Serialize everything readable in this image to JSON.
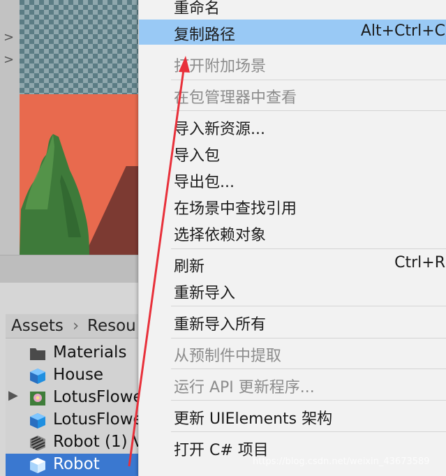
{
  "scene_panel": {
    "chevrons": [
      ">",
      ">"
    ]
  },
  "project_panel": {
    "breadcrumb": {
      "root": "Assets",
      "separator": "›",
      "current": "Resou"
    },
    "items": [
      {
        "label": "Materials",
        "icon": "folder-icon"
      },
      {
        "label": "House",
        "icon": "prefab-cube-icon"
      },
      {
        "label": "LotusFlowe",
        "icon": "lotus-prefab-icon",
        "expandable": true
      },
      {
        "label": "LotusFlowe",
        "icon": "prefab-cube-icon"
      },
      {
        "label": "Robot (1) V",
        "icon": "prefab-variant-icon"
      },
      {
        "label": "Robot",
        "icon": "prefab-cube-icon",
        "selected": true
      }
    ]
  },
  "context_menu": {
    "items": [
      {
        "label": "重命名",
        "enabled": true
      },
      {
        "label": "复制路径",
        "shortcut": "Alt+Ctrl+C",
        "enabled": true,
        "highlighted": true
      },
      {
        "label": "打开附加场景",
        "enabled": false
      },
      {
        "label": "在包管理器中查看",
        "enabled": false
      },
      {
        "label": "导入新资源...",
        "enabled": true
      },
      {
        "label": "导入包",
        "enabled": true
      },
      {
        "label": "导出包...",
        "enabled": true
      },
      {
        "label": "在场景中查找引用",
        "enabled": true
      },
      {
        "label": "选择依赖对象",
        "enabled": true
      },
      {
        "label": "刷新",
        "shortcut": "Ctrl+R",
        "enabled": true
      },
      {
        "label": "重新导入",
        "enabled": true
      },
      {
        "label": "重新导入所有",
        "enabled": true
      },
      {
        "label": "从预制件中提取",
        "enabled": false
      },
      {
        "label": "运行 API 更新程序...",
        "enabled": false
      },
      {
        "label": "更新 UIElements 架构",
        "enabled": true
      },
      {
        "label": "打开 C# 项目",
        "enabled": true
      }
    ]
  },
  "watermark": "https://blog.csdn.net/weixin_43673589",
  "colors": {
    "menu_bg": "#f2f2f2",
    "menu_highlight": "#99c9f5",
    "selection": "#3a78d0",
    "annotation_arrow": "#e8303a"
  }
}
